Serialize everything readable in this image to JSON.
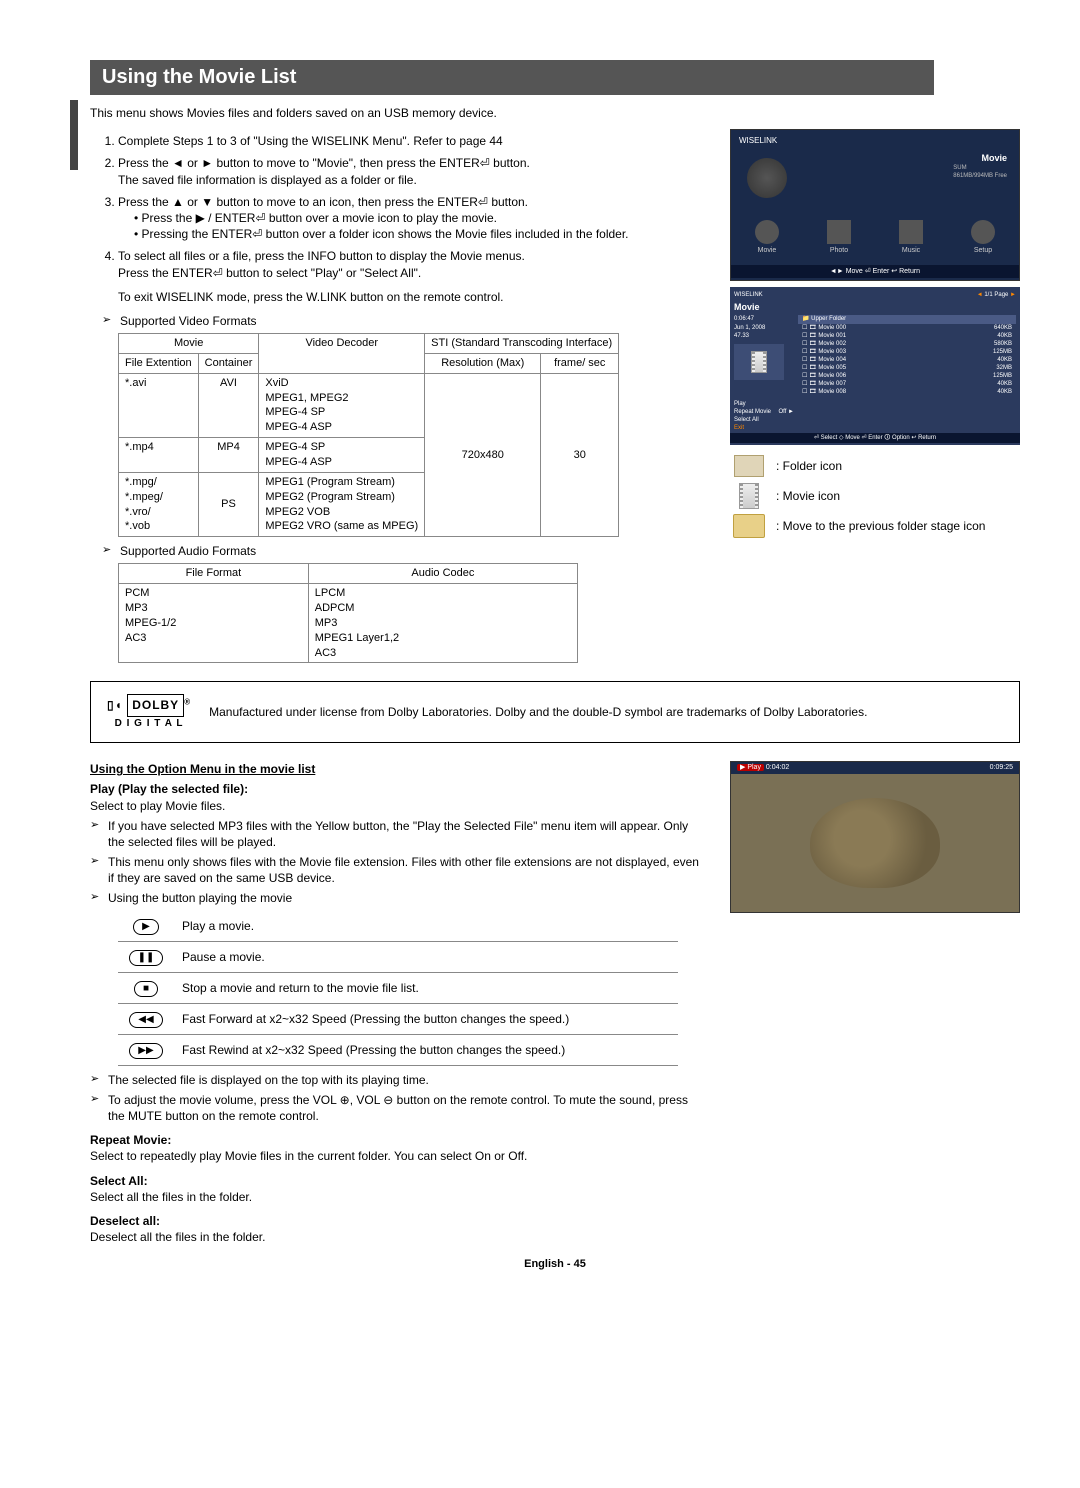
{
  "title": "Using the Movie List",
  "intro": "This menu shows Movies files and folders saved on an USB memory device.",
  "steps": [
    {
      "n": "1.",
      "text": "Complete Steps 1 to 3 of \"Using the WISELINK Menu\". Refer to page 44"
    },
    {
      "n": "2.",
      "text": "Press the ◄ or ► button to move to \"Movie\", then press the ENTER⏎ button.",
      "sub": "The saved file information is displayed as a folder or file."
    },
    {
      "n": "3.",
      "text": "Press the ▲ or ▼ button to move to an icon, then press the ENTER⏎ button.",
      "bullets": [
        "Press the ▶ / ENTER⏎ button over a movie icon to play the movie.",
        "Pressing the ENTER⏎ button over a folder icon shows the Movie files included in the folder."
      ]
    },
    {
      "n": "4.",
      "text": "To select all files or a file, press the INFO button to display the Movie menus.",
      "sub": "Press the ENTER⏎ button to select \"Play\" or \"Select All\".",
      "extra": "To exit WISELINK mode, press the W.LINK button on the remote control."
    }
  ],
  "video_header": "Supported Video Formats",
  "video_table": {
    "h_movie": "Movie",
    "h_decoder": "Video Decoder",
    "h_sti": "STI (Standard Transcoding Interface)",
    "h_ext": "File Extention",
    "h_cont": "Container",
    "h_res": "Resolution (Max)",
    "h_fps": "frame/ sec",
    "rows": [
      {
        "ext": "*.avi",
        "cont": "AVI",
        "dec": "XviD\nMPEG1, MPEG2\nMPEG-4 SP\nMPEG-4 ASP",
        "res": "720x480",
        "fps": "30"
      },
      {
        "ext": "*.mp4",
        "cont": "MP4",
        "dec": "MPEG-4 SP\nMPEG-4 ASP"
      },
      {
        "ext": "*.mpg/\n*.mpeg/\n*.vro/\n*.vob",
        "cont": "PS",
        "dec": "MPEG1 (Program Stream)\nMPEG2 (Program Stream)\nMPEG2 VOB\nMPEG2 VRO (same as MPEG)"
      }
    ]
  },
  "audio_header": "Supported Audio Formats",
  "audio_table": {
    "h_file": "File Format",
    "h_codec": "Audio Codec",
    "files": "PCM\nMP3\nMPEG-1/2\nAC3",
    "codecs": "LPCM\nADPCM\nMP3\nMPEG1 Layer1,2\nAC3"
  },
  "dolby": "Manufactured under license from Dolby Laboratories. Dolby and the double-D symbol are trademarks of Dolby Laboratories.",
  "dolby_logo_top": "DOLBY",
  "dolby_logo_bot": "D I G I T A L",
  "option_h": "Using the Option Menu in the movie list",
  "play_h": "Play (Play the selected file):",
  "play_desc": "Select to play Movie files.",
  "play_notes": [
    "If you have selected MP3 files with the Yellow button, the \"Play the Selected File\" menu item will appear. Only the selected files will be played.",
    "This menu only shows files with the Movie file extension. Files with other file extensions are not displayed, even if they are saved on the same USB device.",
    "Using the button playing the movie"
  ],
  "ctrl": [
    {
      "icon": "▶",
      "text": "Play a movie."
    },
    {
      "icon": "❚❚",
      "text": "Pause a movie."
    },
    {
      "icon": "■",
      "text": "Stop a movie and return to the movie file list."
    },
    {
      "icon": "◀◀",
      "text": "Fast Forward at x2~x32 Speed (Pressing the button changes the speed.)"
    },
    {
      "icon": "▶▶",
      "text": "Fast Rewind at x2~x32 Speed (Pressing the button changes the speed.)"
    }
  ],
  "after_ctrl": [
    "The selected file is displayed on the top with its playing time.",
    "To adjust the movie volume, press the VOL ⊕, VOL ⊖ button on the remote control. To mute the sound, press the MUTE button on the remote control."
  ],
  "repeat_h": "Repeat Movie:",
  "repeat_t": "Select to repeatedly play Movie files in the current folder. You can select On or Off.",
  "selall_h": "Select All:",
  "selall_t": "Select all the files in the folder.",
  "desel_h": "Deselect all:",
  "desel_t": "Deselect all the files in the folder.",
  "pagefoot": "English - 45",
  "wiselink": {
    "hdr": "WISELINK",
    "label": "Movie",
    "sub": "SUM\n861MB/994MB Free",
    "menu": [
      "Movie",
      "Photo",
      "Music",
      "Setup"
    ],
    "bar": "◄► Move     ⏎ Enter     ↩ Return"
  },
  "mlist": {
    "hdr": "WISELINK",
    "title": "Movie",
    "page": "1/1 Page",
    "time": "0:06:47",
    "date": "Jun 1, 2008",
    "size": "47.33",
    "upper": "Upper Folder",
    "items": [
      {
        "n": "Movie 000",
        "s": "640KB"
      },
      {
        "n": "Movie 001",
        "s": "40KB"
      },
      {
        "n": "Movie 002",
        "s": "580KB"
      },
      {
        "n": "Movie 003",
        "s": "125MB"
      },
      {
        "n": "Movie 004",
        "s": "40KB"
      },
      {
        "n": "Movie 005",
        "s": "32MB"
      },
      {
        "n": "Movie 006",
        "s": "125MB"
      },
      {
        "n": "Movie 007",
        "s": "40KB"
      },
      {
        "n": "Movie 008",
        "s": "40KB"
      }
    ],
    "opts_play": "Play",
    "opts_repeat": "Repeat Movie",
    "opts_repeat_v": "Off ►",
    "opts_sel": "Select All",
    "opts_exit": "Exit",
    "bar": "⏎ Select  ◇ Move  ⏎ Enter  🛈 Option  ↩ Return"
  },
  "legend": {
    "folder": ": Folder icon",
    "movie": ": Movie icon",
    "prev": ": Move to the previous folder stage icon"
  },
  "playback": {
    "play": "▶ Play",
    "t1": "0:04:02",
    "t2": "0:09:25"
  }
}
